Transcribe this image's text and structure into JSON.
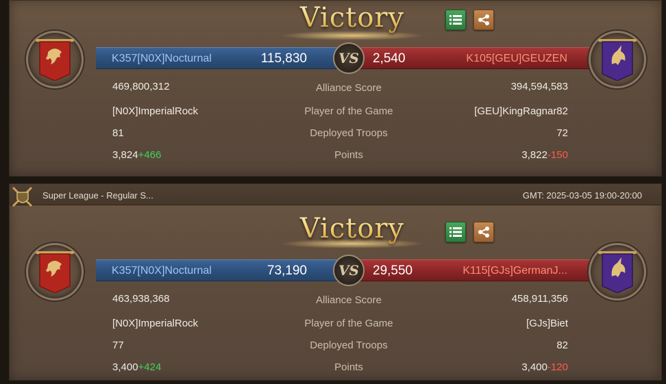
{
  "battles": [
    {
      "victory_label": "Victory",
      "left_team": "K357[N0X]Nocturnal",
      "left_score": "115,830",
      "vs_label": "VS",
      "right_score": "2,540",
      "right_team": "K105[GEU]GEUZEN",
      "rows": {
        "alliance_score": {
          "label": "Alliance Score",
          "left": "469,800,312",
          "right": "394,594,583"
        },
        "player_of_game": {
          "label": "Player of the Game",
          "left": "[N0X]ImperialRock",
          "right": "[GEU]KingRagnar82"
        },
        "deployed_troops": {
          "label": "Deployed Troops",
          "left": "81",
          "right": "72"
        },
        "points": {
          "label": "Points",
          "left": "3,824",
          "left_delta": "+466",
          "right": "3,822",
          "right_delta": "-150"
        }
      }
    },
    {
      "league": "Super League - Regular S...",
      "gmt": "GMT: 2025-03-05 19:00-20:00",
      "victory_label": "Victory",
      "left_team": "K357[N0X]Nocturnal",
      "left_score": "73,190",
      "vs_label": "VS",
      "right_score": "29,550",
      "right_team": "K115[GJs]GermanJ...",
      "rows": {
        "alliance_score": {
          "label": "Alliance Score",
          "left": "463,938,368",
          "right": "458,911,356"
        },
        "player_of_game": {
          "label": "Player of the Game",
          "left": "[N0X]ImperialRock",
          "right": "[GJs]Biet"
        },
        "deployed_troops": {
          "label": "Deployed Troops",
          "left": "77",
          "right": "82"
        },
        "points": {
          "label": "Points",
          "left": "3,400",
          "left_delta": "+424",
          "right": "3,400",
          "right_delta": "-120"
        }
      }
    }
  ],
  "icons": {
    "list": "list-icon",
    "share": "share-icon",
    "left_emblem": "red-dragon-banner-icon",
    "right_emblem": "purple-unicorn-banner-icon",
    "league": "crossed-swords-shield-icon"
  },
  "colors": {
    "left_bar": "#2c4f7c",
    "right_bar": "#8a2526",
    "victory_gold": "#f2cf72",
    "delta_plus": "#42d35c",
    "delta_minus": "#ff5a4e"
  }
}
